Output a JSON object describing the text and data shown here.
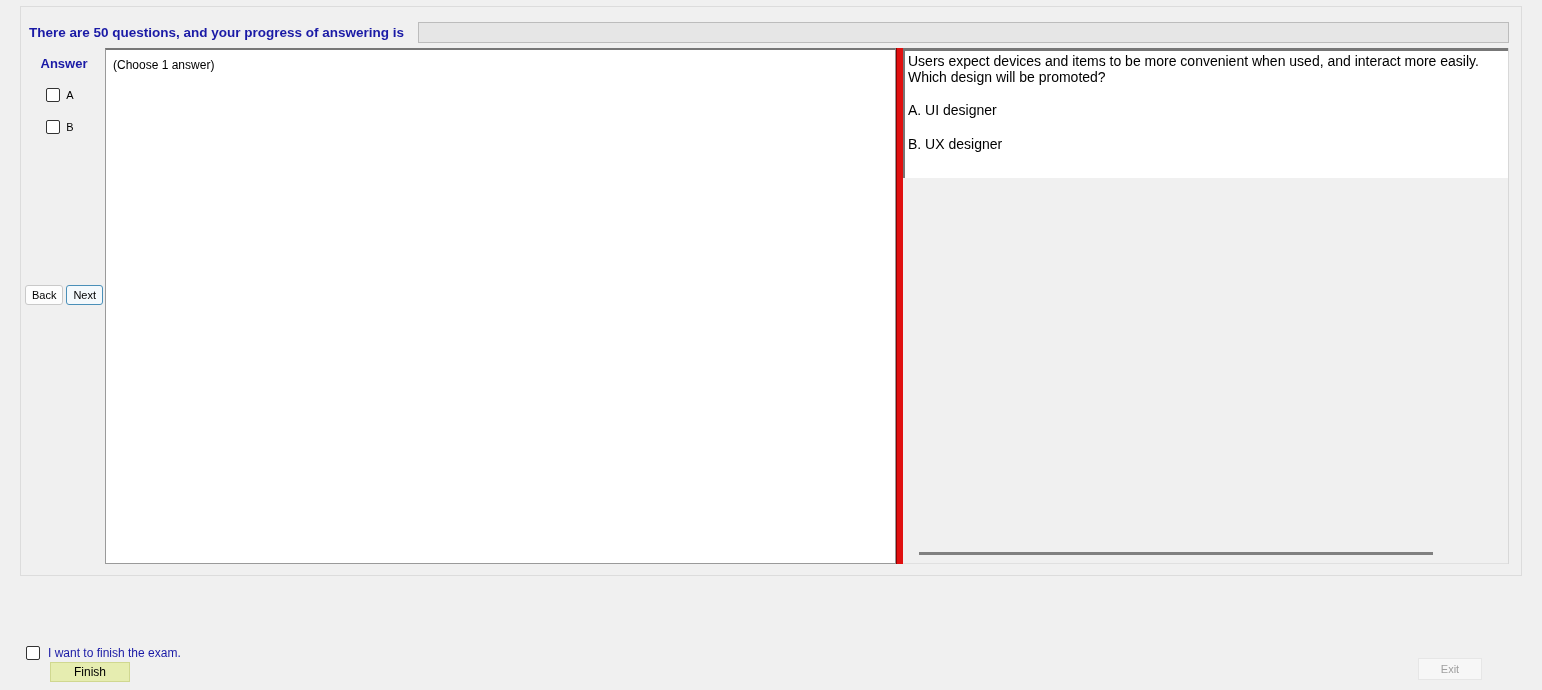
{
  "header": {
    "text": "There are 50 questions, and your progress of answering is",
    "progress": {
      "level": 0
    }
  },
  "answer_panel": {
    "title": "Answer",
    "options": [
      {
        "label": "A",
        "checked": false
      },
      {
        "label": "B",
        "checked": false
      }
    ],
    "back": "Back",
    "next": "Next"
  },
  "answer_box": {
    "hint": "(Choose 1 answer)"
  },
  "question": {
    "lines": [
      "Users expect devices and items to be more convenient when used, and interact more easily.",
      "Which design will be promoted?"
    ],
    "choices": [
      "A.  UI designer",
      "B.  UX designer"
    ]
  },
  "finish": {
    "label": "I want to finish the exam.",
    "checked": false,
    "button": "Finish"
  },
  "exit": {
    "label": "Exit",
    "disabled": true
  }
}
